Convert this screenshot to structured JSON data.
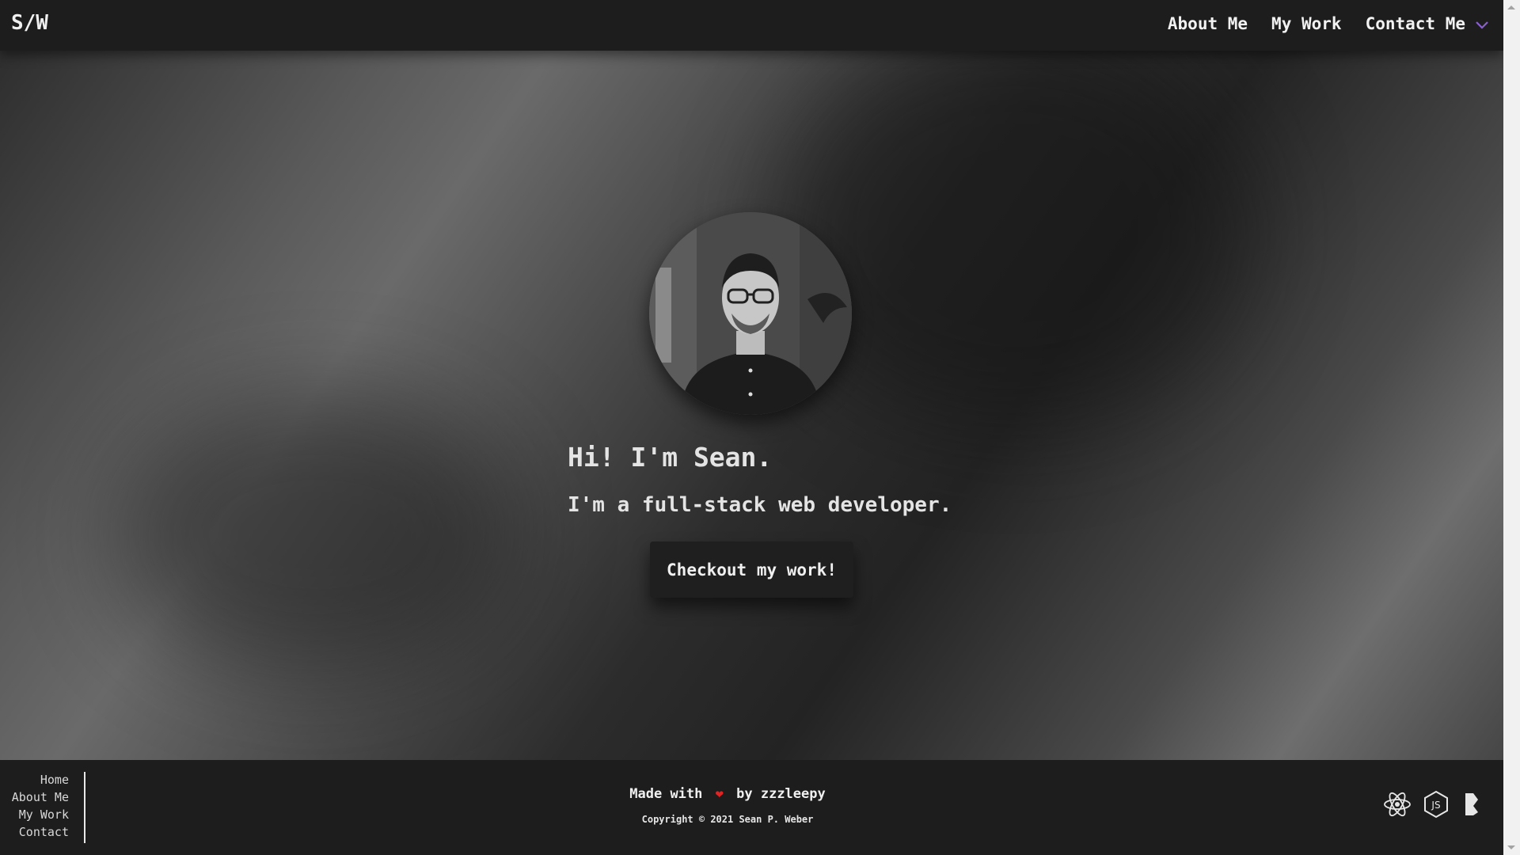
{
  "header": {
    "logo": "S/W",
    "nav": [
      {
        "label": "About Me"
      },
      {
        "label": "My Work"
      },
      {
        "label": "Contact Me"
      }
    ],
    "accent_color": "#8a5fd0"
  },
  "hero": {
    "greeting": "Hi! I'm Sean.",
    "tagline": "I'm a full-stack web developer.",
    "cta_label": "Checkout my work!",
    "avatar_icon": "profile-photo"
  },
  "footer": {
    "links": [
      "Home",
      "About Me",
      "My Work",
      "Contact"
    ],
    "made_with_prefix": "Made with",
    "made_with_suffix": "by zzzleepy",
    "heart_symbol": "❤",
    "heart_color": "#e02424",
    "copyright": "Copyright © 2021 Sean P. Weber",
    "tech_icons": [
      "react-icon",
      "nodejs-icon",
      "bootstrap-icon"
    ]
  }
}
